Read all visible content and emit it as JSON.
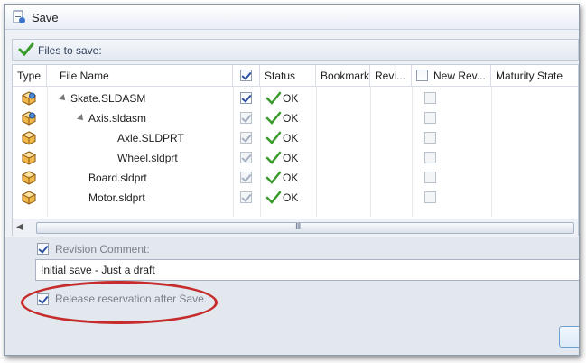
{
  "window": {
    "title": "Save",
    "files_header": "Files to save:"
  },
  "grid": {
    "columns": {
      "type": "Type",
      "file_name": "File Name",
      "status": "Status",
      "bookmark": "Bookmark",
      "revision": "Revi...",
      "new_revision": "New Rev...",
      "maturity": "Maturity State"
    },
    "header_save_checked": true,
    "header_newrev_checked": false,
    "rows": [
      {
        "icon": "assembly-icon",
        "indent": 0,
        "expand": true,
        "name": "Skate.SLDASM",
        "save_checked": true,
        "save_enabled": true,
        "status": "OK",
        "new_rev_checked": false
      },
      {
        "icon": "assembly-icon",
        "indent": 1,
        "expand": true,
        "name": "Axis.sldasm",
        "save_checked": true,
        "save_enabled": false,
        "status": "OK",
        "new_rev_checked": false
      },
      {
        "icon": "part-icon",
        "indent": 2,
        "expand": false,
        "name": "Axle.SLDPRT",
        "save_checked": true,
        "save_enabled": false,
        "status": "OK",
        "new_rev_checked": false
      },
      {
        "icon": "part-icon",
        "indent": 2,
        "expand": false,
        "name": "Wheel.sldprt",
        "save_checked": true,
        "save_enabled": false,
        "status": "OK",
        "new_rev_checked": false
      },
      {
        "icon": "part-icon",
        "indent": 1,
        "expand": false,
        "name": "Board.sldprt",
        "save_checked": true,
        "save_enabled": false,
        "status": "OK",
        "new_rev_checked": false
      },
      {
        "icon": "part-icon",
        "indent": 1,
        "expand": false,
        "name": "Motor.sldprt",
        "save_checked": true,
        "save_enabled": false,
        "status": "OK",
        "new_rev_checked": false
      }
    ],
    "scroll_left_icon": "chevron-left-icon",
    "scroll_grip": "III"
  },
  "revision_comment": {
    "label": "Revision Comment:",
    "checked": true,
    "value": "Initial save - Just a draft"
  },
  "release_reservation": {
    "label": "Release reservation after Save.",
    "checked": true
  },
  "colors": {
    "highlight_ellipse": "#c62c2c",
    "ok_green": "#3a9b2c",
    "checkbox_blue": "#2b4f9e"
  }
}
